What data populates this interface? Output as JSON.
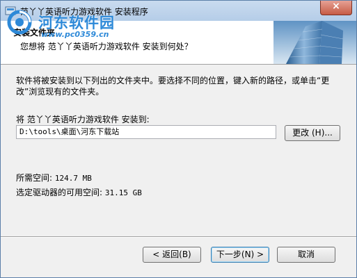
{
  "window": {
    "title": "范丫丫英语听力游戏软件 安装程序",
    "close_symbol": "×"
  },
  "watermark": {
    "text": "河东软件园",
    "url": "www.pc0359.cn"
  },
  "header": {
    "title": "安装文件夹",
    "subtitle": "您想将 范丫丫英语听力游戏软件 安装到何处？"
  },
  "body": {
    "description": "软件将被安装到以下列出的文件夹中。要选择不同的位置，键入新的路径，或单击“更改”浏览现有的文件夹。",
    "install_label": "将 范丫丫英语听力游戏软件 安装到:",
    "install_path": "D:\\tools\\桌面\\河东下载站",
    "browse_label": "更改 (H)...",
    "space_required_label": "所需空间:",
    "space_required_value": "124.7 MB",
    "space_available_label": "选定驱动器的可用空间:",
    "space_available_value": "31.15 GB"
  },
  "footer": {
    "back_label": "< 返回(B)",
    "next_label": "下一步(N) >",
    "cancel_label": "取消"
  }
}
